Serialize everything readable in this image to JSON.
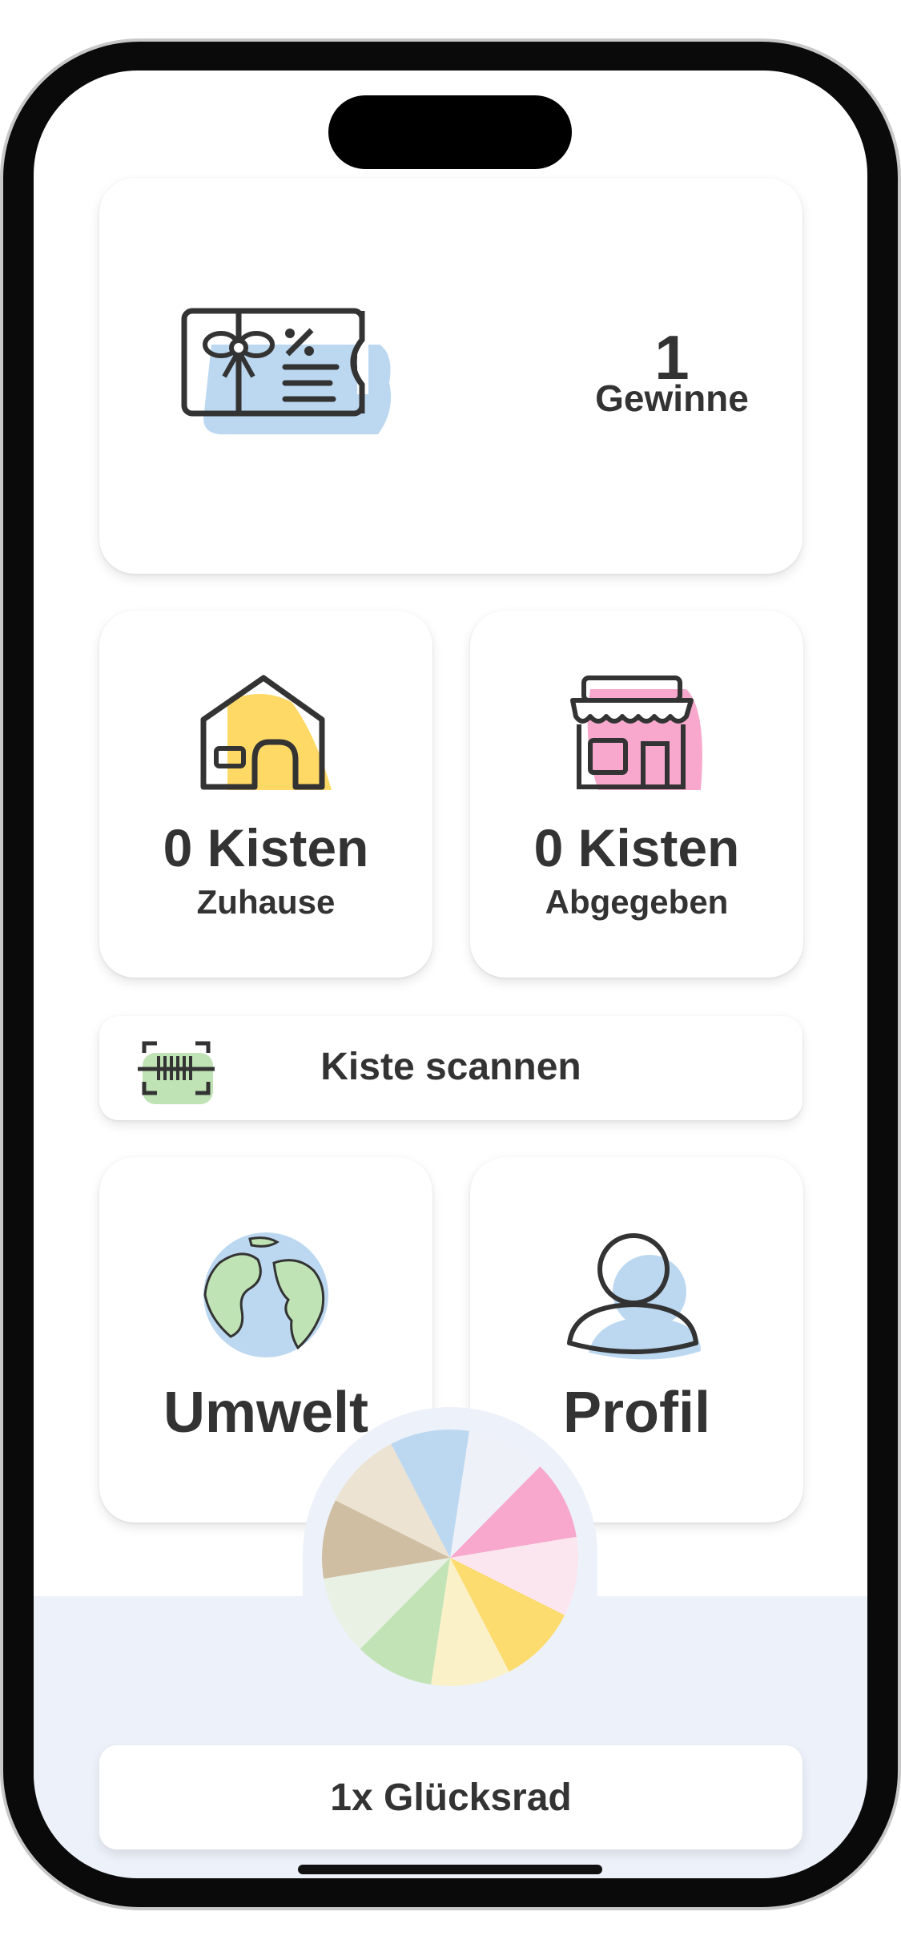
{
  "wins": {
    "count": "1",
    "label": "Gewinne",
    "icon": "gift-voucher-icon"
  },
  "boxes": [
    {
      "count_label": "0 Kisten",
      "caption": "Zuhause",
      "icon": "house-icon",
      "accent": "#ffd966"
    },
    {
      "count_label": "0 Kisten",
      "caption": "Abgegeben",
      "icon": "store-icon",
      "accent": "#f7a8cc"
    }
  ],
  "scan": {
    "label": "Kiste scannen",
    "icon": "barcode-scan-icon",
    "accent": "#bfe3b4"
  },
  "nav": [
    {
      "label": "Umwelt",
      "icon": "globe-icon"
    },
    {
      "label": "Profil",
      "icon": "user-icon"
    }
  ],
  "wheel": {
    "icon": "fortune-wheel-icon",
    "segment_colors": [
      "#eef1f8",
      "#f7a8cc",
      "#fbe6ef",
      "#fcdc6e",
      "#fbf1c8",
      "#c2e3b6",
      "#e9f1e5",
      "#cfbea1",
      "#ece3d3",
      "#bcd8f0"
    ]
  },
  "spin": {
    "label": "1x Glücksrad"
  },
  "colors": {
    "accent_blue": "#bcd8f0",
    "background_bottom": "#edf1f9",
    "text": "#333333"
  }
}
